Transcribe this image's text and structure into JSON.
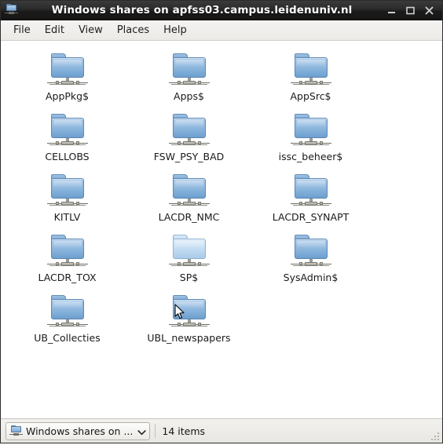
{
  "window": {
    "title": "Windows shares on apfss03.campus.leidenuniv.nl",
    "title_icon": "network-share-folder-icon",
    "controls": {
      "minimize": "minimize-button",
      "maximize": "maximize-button",
      "close": "close-button"
    }
  },
  "menubar": {
    "items": [
      {
        "label": "File"
      },
      {
        "label": "Edit"
      },
      {
        "label": "View"
      },
      {
        "label": "Places"
      },
      {
        "label": "Help"
      }
    ]
  },
  "iconview": {
    "items": [
      {
        "label": "AppPkg$",
        "icon": "network-share-folder-icon",
        "state": "normal"
      },
      {
        "label": "Apps$",
        "icon": "network-share-folder-icon",
        "state": "normal"
      },
      {
        "label": "AppSrc$",
        "icon": "network-share-folder-icon",
        "state": "normal"
      },
      {
        "label": "CELLOBS",
        "icon": "network-share-folder-icon",
        "state": "normal"
      },
      {
        "label": "FSW_PSY_BAD",
        "icon": "network-share-folder-icon",
        "state": "normal"
      },
      {
        "label": "issc_beheer$",
        "icon": "network-share-folder-icon",
        "state": "normal"
      },
      {
        "label": "KITLV",
        "icon": "network-share-folder-icon",
        "state": "normal"
      },
      {
        "label": "LACDR_NMC",
        "icon": "network-share-folder-icon",
        "state": "normal"
      },
      {
        "label": "LACDR_SYNAPT",
        "icon": "network-share-folder-icon",
        "state": "normal"
      },
      {
        "label": "LACDR_TOX",
        "icon": "network-share-folder-icon",
        "state": "normal"
      },
      {
        "label": "SP$",
        "icon": "network-share-folder-icon",
        "state": "prelight"
      },
      {
        "label": "SysAdmin$",
        "icon": "network-share-folder-icon",
        "state": "normal"
      },
      {
        "label": "UB_Collecties",
        "icon": "network-share-folder-icon",
        "state": "normal"
      },
      {
        "label": "UBL_newspapers",
        "icon": "network-share-folder-icon",
        "state": "normal"
      }
    ]
  },
  "statusbar": {
    "path_combo": {
      "icon": "network-share-folder-icon",
      "label": "Windows shares on ...",
      "arrow": "chevron-down-icon"
    },
    "item_count": "14 items",
    "resize_grip": "resize-grip"
  },
  "cursor": {
    "type": "arrow-pointer"
  },
  "colors": {
    "titlebar_dark": "#1b1b1b",
    "titlebar_text": "#ffffff",
    "menubar_bg": "#efedea",
    "content_bg": "#ffffff",
    "statusbar_bg": "#ecebe7",
    "folder_blue": "#7cabd7",
    "folder_blue_prelight": "#c9e0f4",
    "text": "#1a1a1a"
  }
}
